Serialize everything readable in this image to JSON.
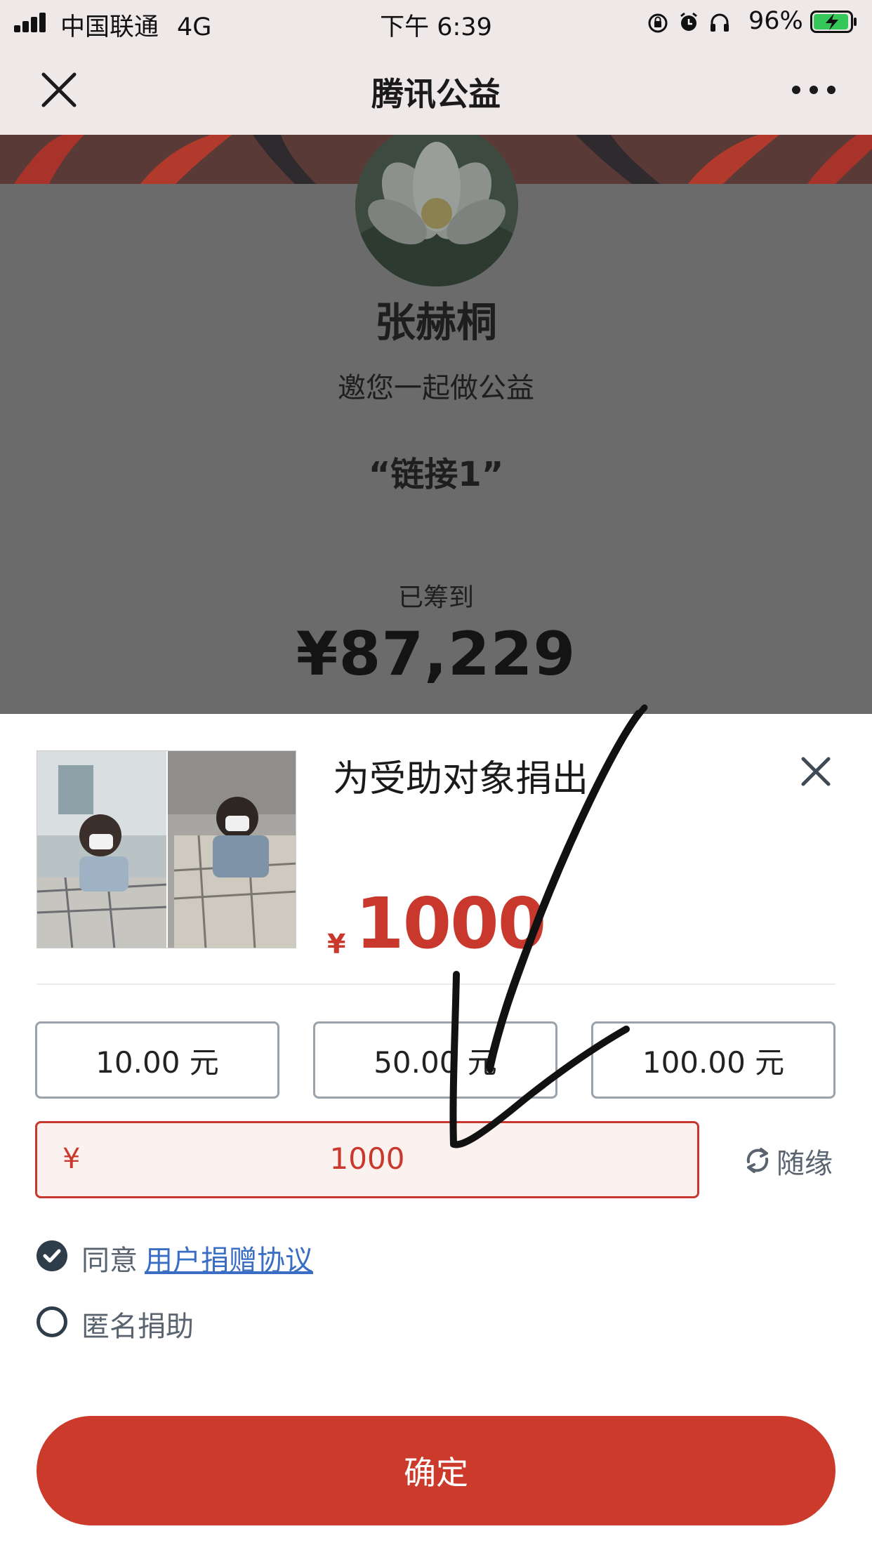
{
  "status_bar": {
    "carrier": "中国联通",
    "network": "4G",
    "time": "下午 6:39",
    "battery_percent": "96%",
    "battery_level": 0.96
  },
  "nav": {
    "title": "腾讯公益"
  },
  "background_page": {
    "name": "张赫桐",
    "invite_text": "邀您一起做公益",
    "quote": "“链接1”",
    "raised_label": "已筹到",
    "raised_amount": "¥87,229"
  },
  "donation_sheet": {
    "title": "为受助对象捐出",
    "currency_sign": "¥",
    "amount": "1000",
    "presets": [
      "10.00 元",
      "50.00 元",
      "100.00 元"
    ],
    "custom_input": {
      "currency_sign": "¥",
      "value": "1000"
    },
    "random_label": "随缘",
    "agree": {
      "checked": true,
      "prefix": "同意",
      "link_text": "用户捐赠协议"
    },
    "anonymous": {
      "checked": false,
      "label": "匿名捐助"
    },
    "confirm_label": "确定"
  },
  "colors": {
    "accent_red": "#cc3a2b",
    "nav_bg": "#efe8e8",
    "overlay_gray": "#6b6b6b",
    "link_blue": "#3a6ec4",
    "check_dark": "#2f3d4a"
  },
  "icons": [
    "signal-icon",
    "orientation-lock-icon",
    "alarm-icon",
    "headphones-icon",
    "battery-charging-icon",
    "close-icon",
    "more-icon",
    "refresh-icon",
    "check-circle-icon",
    "radio-empty-icon"
  ]
}
